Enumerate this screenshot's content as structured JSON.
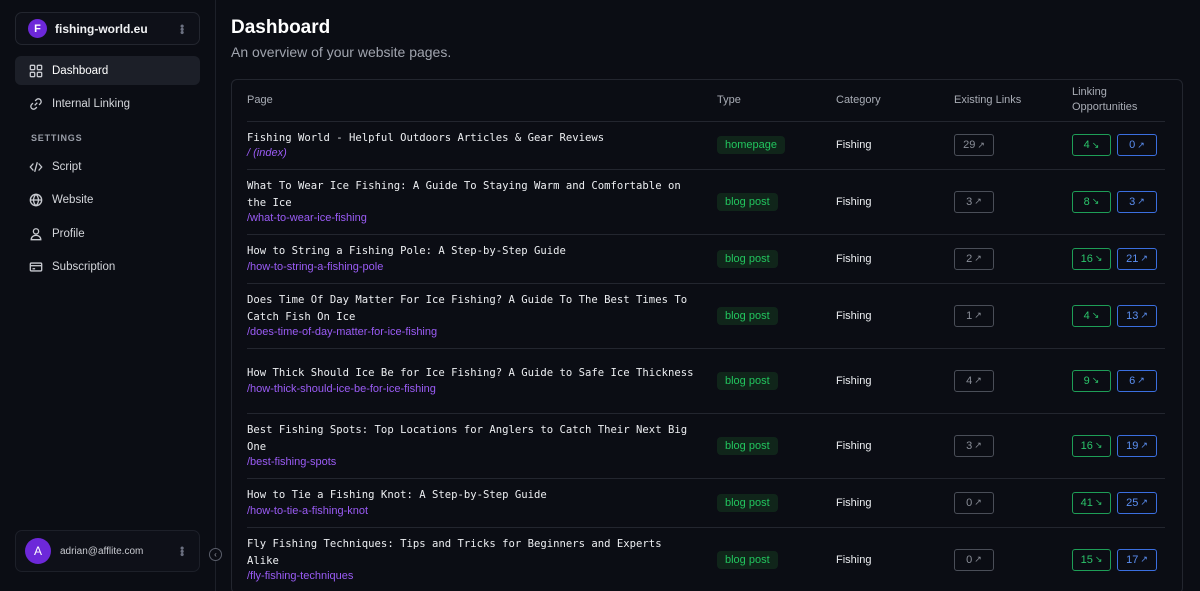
{
  "sidebar": {
    "site": {
      "initial": "F",
      "name": "fishing-world.eu"
    },
    "nav": [
      {
        "label": "Dashboard",
        "icon": "grid-icon",
        "active": true
      },
      {
        "label": "Internal Linking",
        "icon": "link-icon",
        "active": false
      }
    ],
    "settings_label": "SETTINGS",
    "settings": [
      {
        "label": "Script",
        "icon": "code-icon"
      },
      {
        "label": "Website",
        "icon": "globe-icon"
      },
      {
        "label": "Profile",
        "icon": "user-icon"
      },
      {
        "label": "Subscription",
        "icon": "credit-card-icon"
      }
    ],
    "user": {
      "initial": "A",
      "email": "adrian@afflite.com"
    }
  },
  "main": {
    "title": "Dashboard",
    "subtitle": "An overview of your website pages.",
    "table": {
      "headers": [
        "Page",
        "Type",
        "Category",
        "Existing Links",
        "Linking Opportunities"
      ],
      "rows": [
        {
          "title": "Fishing World - Helpful Outdoors Articles & Gear Reviews",
          "path": "/ (index)",
          "type": "homepage",
          "category": "Fishing",
          "existing": "29",
          "opp_in": "4",
          "opp_out": "0"
        },
        {
          "title": "What To Wear Ice Fishing: A Guide To Staying Warm and Comfortable on the Ice",
          "path": "/what-to-wear-ice-fishing",
          "type": "blog post",
          "category": "Fishing",
          "existing": "3",
          "opp_in": "8",
          "opp_out": "3"
        },
        {
          "title": "How to String a Fishing Pole: A Step-by-Step Guide",
          "path": "/how-to-string-a-fishing-pole",
          "type": "blog post",
          "category": "Fishing",
          "existing": "2",
          "opp_in": "16",
          "opp_out": "21"
        },
        {
          "title": "Does Time Of Day Matter For Ice Fishing? A Guide To The Best Times To Catch Fish On Ice",
          "path": "/does-time-of-day-matter-for-ice-fishing",
          "type": "blog post",
          "category": "Fishing",
          "existing": "1",
          "opp_in": "4",
          "opp_out": "13"
        },
        {
          "title": "How Thick Should Ice Be for Ice Fishing? A Guide to Safe Ice Thickness",
          "path": "/how-thick-should-ice-be-for-ice-fishing",
          "type": "blog post",
          "category": "Fishing",
          "existing": "4",
          "opp_in": "9",
          "opp_out": "6"
        },
        {
          "title": "Best Fishing Spots: Top Locations for Anglers to Catch Their Next Big One",
          "path": "/best-fishing-spots",
          "type": "blog post",
          "category": "Fishing",
          "existing": "3",
          "opp_in": "16",
          "opp_out": "19"
        },
        {
          "title": "How to Tie a Fishing Knot: A Step-by-Step Guide",
          "path": "/how-to-tie-a-fishing-knot",
          "type": "blog post",
          "category": "Fishing",
          "existing": "0",
          "opp_in": "41",
          "opp_out": "25"
        },
        {
          "title": "Fly Fishing Techniques: Tips and Tricks for Beginners and Experts Alike",
          "path": "/fly-fishing-techniques",
          "type": "blog post",
          "category": "Fishing",
          "existing": "0",
          "opp_in": "15",
          "opp_out": "17"
        }
      ]
    }
  }
}
